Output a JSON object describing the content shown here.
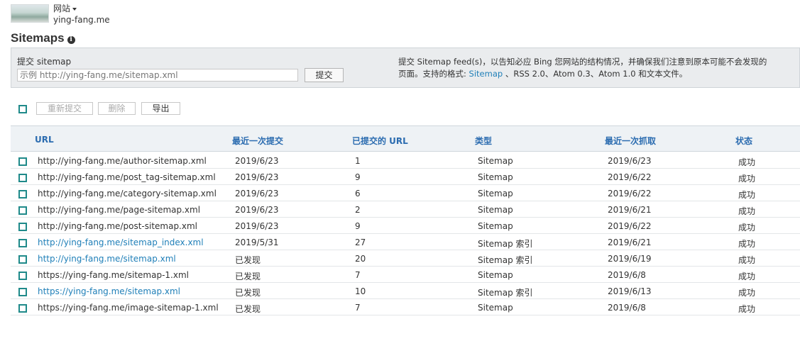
{
  "header": {
    "site_menu_label": "网站",
    "site_url": "ying-fang.me"
  },
  "page": {
    "title": "Sitemaps"
  },
  "submit_panel": {
    "label": "提交 sitemap",
    "input_value": "",
    "input_placeholder": "示例 http://ying-fang.me/sitemap.xml",
    "submit_button": "提交",
    "help_line1": "提交 Sitemap feed(s)，以告知必应 Bing 您网站的结构情况，并确保我们注意到原本可能不会发现的",
    "help_line2_prefix": "页面。支持的格式: ",
    "help_link_sitemap": "Sitemap",
    "help_line2_suffix": " 、RSS 2.0、Atom 0.3、Atom 1.0 和文本文件。"
  },
  "toolbar": {
    "resubmit": "重新提交",
    "delete": "删除",
    "export": "导出"
  },
  "table": {
    "columns": {
      "url": "URL",
      "last_submitted": "最近一次提交",
      "submitted_urls": "已提交的 URL",
      "type": "类型",
      "last_crawled": "最近一次抓取",
      "status": "状态"
    },
    "rows": [
      {
        "url": "http://ying-fang.me/author-sitemap.xml",
        "link": false,
        "submitted": "2019/6/23",
        "count": "1",
        "type": "Sitemap",
        "crawled": "2019/6/23",
        "status": "成功"
      },
      {
        "url": "http://ying-fang.me/post_tag-sitemap.xml",
        "link": false,
        "submitted": "2019/6/23",
        "count": "9",
        "type": "Sitemap",
        "crawled": "2019/6/22",
        "status": "成功"
      },
      {
        "url": "http://ying-fang.me/category-sitemap.xml",
        "link": false,
        "submitted": "2019/6/23",
        "count": "6",
        "type": "Sitemap",
        "crawled": "2019/6/22",
        "status": "成功"
      },
      {
        "url": "http://ying-fang.me/page-sitemap.xml",
        "link": false,
        "submitted": "2019/6/23",
        "count": "2",
        "type": "Sitemap",
        "crawled": "2019/6/21",
        "status": "成功"
      },
      {
        "url": "http://ying-fang.me/post-sitemap.xml",
        "link": false,
        "submitted": "2019/6/23",
        "count": "9",
        "type": "Sitemap",
        "crawled": "2019/6/22",
        "status": "成功"
      },
      {
        "url": "http://ying-fang.me/sitemap_index.xml",
        "link": true,
        "submitted": "2019/5/31",
        "count": "27",
        "type": "Sitemap 索引",
        "crawled": "2019/6/21",
        "status": "成功"
      },
      {
        "url": "http://ying-fang.me/sitemap.xml",
        "link": true,
        "submitted": "已发现",
        "count": "20",
        "type": "Sitemap 索引",
        "crawled": "2019/6/19",
        "status": "成功"
      },
      {
        "url": "https://ying-fang.me/sitemap-1.xml",
        "link": false,
        "submitted": "已发现",
        "count": "7",
        "type": "Sitemap",
        "crawled": "2019/6/8",
        "status": "成功"
      },
      {
        "url": "https://ying-fang.me/sitemap.xml",
        "link": true,
        "submitted": "已发现",
        "count": "10",
        "type": "Sitemap 索引",
        "crawled": "2019/6/13",
        "status": "成功"
      },
      {
        "url": "https://ying-fang.me/image-sitemap-1.xml",
        "link": false,
        "submitted": "已发现",
        "count": "7",
        "type": "Sitemap",
        "crawled": "2019/6/8",
        "status": "成功"
      }
    ]
  },
  "colors": {
    "accent_teal": "#1f8a8a",
    "link_blue": "#1f7fb8",
    "header_blue": "#2b6cb0"
  }
}
